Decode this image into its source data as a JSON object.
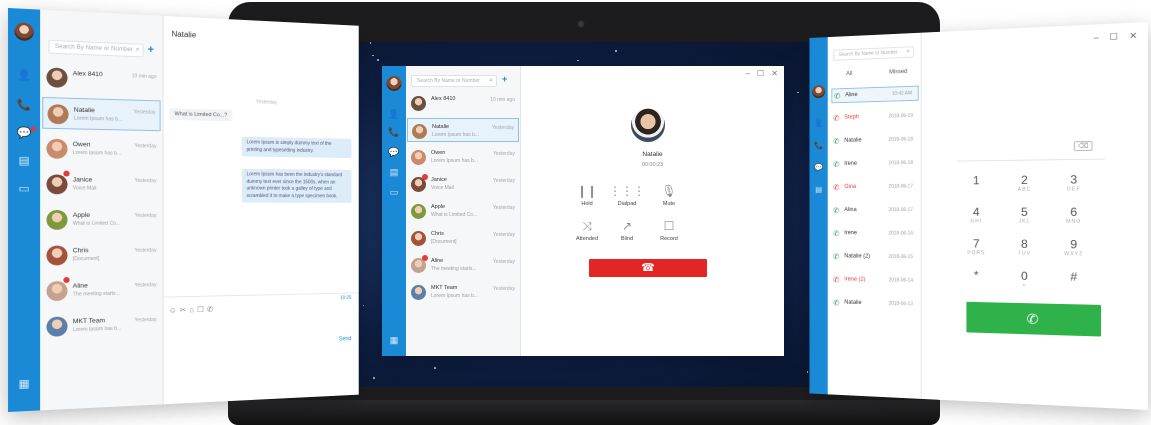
{
  "colors": {
    "accent": "#1b8ad6",
    "hangup": "#e32525",
    "call": "#2fb24a",
    "missed": "#e23b3b",
    "answered": "#2aa24a"
  },
  "left_window": {
    "search_placeholder": "Search By Name or Number",
    "chat_title": "Natalie",
    "contacts": [
      {
        "name": "Alex 8410",
        "preview": "",
        "time": "10 min ago"
      },
      {
        "name": "Natalie",
        "preview": "Lorem Ipsum has b...",
        "time": "Yesterday"
      },
      {
        "name": "Owen",
        "preview": "Lorem Ipsum has b...",
        "time": "Yesterday"
      },
      {
        "name": "Janice",
        "preview": "Voice Mail",
        "time": "Yesterday"
      },
      {
        "name": "Apple",
        "preview": "What is Limited Co...",
        "time": "Yesterday"
      },
      {
        "name": "Chris",
        "preview": "[Document]",
        "time": "Yesterday"
      },
      {
        "name": "Aline",
        "preview": "The meeting starts...",
        "time": "Yesterday"
      },
      {
        "name": "MKT Team",
        "preview": "Lorem Ipsum has b...",
        "time": "Yesterday"
      }
    ],
    "day_label": "Yesterday",
    "incoming_message": "What is Limited Co...?",
    "outgoing_messages": [
      "Lorem Ipsum is simply dummy text of the printing and typesetting industry.",
      "Lorem Ipsum has been the industry's standard dummy text ever since the 1500s, when an unknown printer took a galley of type and scrambled it to make a type specimen book."
    ],
    "input_time": "10:25",
    "send_label": "Send"
  },
  "center_window": {
    "search_placeholder": "Search By Name or Number",
    "contacts": [
      {
        "name": "Alex 8410",
        "preview": "",
        "time": "10 min ago"
      },
      {
        "name": "Natalie",
        "preview": "Lorem Ipsum has b...",
        "time": "Yesterday"
      },
      {
        "name": "Owen",
        "preview": "Lorem Ipsum has b...",
        "time": "Yesterday"
      },
      {
        "name": "Janice",
        "preview": "Voice Mail",
        "time": "Yesterday"
      },
      {
        "name": "Apple",
        "preview": "What is Limited Co...",
        "time": "Yesterday"
      },
      {
        "name": "Chris",
        "preview": "[Document]",
        "time": "Yesterday"
      },
      {
        "name": "Aline",
        "preview": "The meeting starts...",
        "time": "Yesterday"
      },
      {
        "name": "MKT Team",
        "preview": "Lorem Ipsum has b...",
        "time": "Yesterday"
      }
    ],
    "caller_name": "Natalie",
    "call_timer": "00:00:23",
    "controls": [
      {
        "label": "Hold",
        "icon": "pause-icon",
        "glyph": "❙❙"
      },
      {
        "label": "Dialpad",
        "icon": "dialpad-icon",
        "glyph": "⋮⋮⋮"
      },
      {
        "label": "Mute",
        "icon": "microphone-icon",
        "glyph": "🎙"
      },
      {
        "label": "Attended",
        "icon": "transfer-icon",
        "glyph": "⤨"
      },
      {
        "label": "Blind",
        "icon": "blind-transfer-icon",
        "glyph": "↗"
      },
      {
        "label": "Record",
        "icon": "record-icon",
        "glyph": "☐"
      }
    ],
    "hangup_glyph": "☎"
  },
  "right_window": {
    "search_placeholder": "Search By Name or Number",
    "tabs": [
      "All",
      "Missed"
    ],
    "calls": [
      {
        "name": "Aline",
        "date": "10:42 AM",
        "status": "answered"
      },
      {
        "name": "Steph",
        "date": "2018-06-19",
        "status": "missed"
      },
      {
        "name": "Natalie",
        "date": "2018-06-18",
        "status": "answered"
      },
      {
        "name": "Irene",
        "date": "2018-06-18",
        "status": "answered"
      },
      {
        "name": "Gina",
        "date": "2018-06-17",
        "status": "missed"
      },
      {
        "name": "Alina",
        "date": "2018-06-17",
        "status": "answered"
      },
      {
        "name": "Irene",
        "date": "2018-06-16",
        "status": "answered"
      },
      {
        "name": "Natalie (2)",
        "date": "2018-06-15",
        "status": "answered"
      },
      {
        "name": "Irene (2)",
        "date": "2018-06-14",
        "status": "missed"
      },
      {
        "name": "Natalie",
        "date": "2018-06-13",
        "status": "answered"
      }
    ],
    "keys": [
      {
        "d": "1",
        "l": ""
      },
      {
        "d": "2",
        "l": "ABC"
      },
      {
        "d": "3",
        "l": "DEF"
      },
      {
        "d": "4",
        "l": "GHI"
      },
      {
        "d": "5",
        "l": "JKL"
      },
      {
        "d": "6",
        "l": "MNO"
      },
      {
        "d": "7",
        "l": "PQRS"
      },
      {
        "d": "8",
        "l": "TUV"
      },
      {
        "d": "9",
        "l": "WXYZ"
      },
      {
        "d": "*",
        "l": ""
      },
      {
        "d": "0",
        "l": "+"
      },
      {
        "d": "#",
        "l": ""
      }
    ],
    "window_controls": [
      "–",
      "☐",
      "✕"
    ],
    "call_glyph": "✆"
  }
}
